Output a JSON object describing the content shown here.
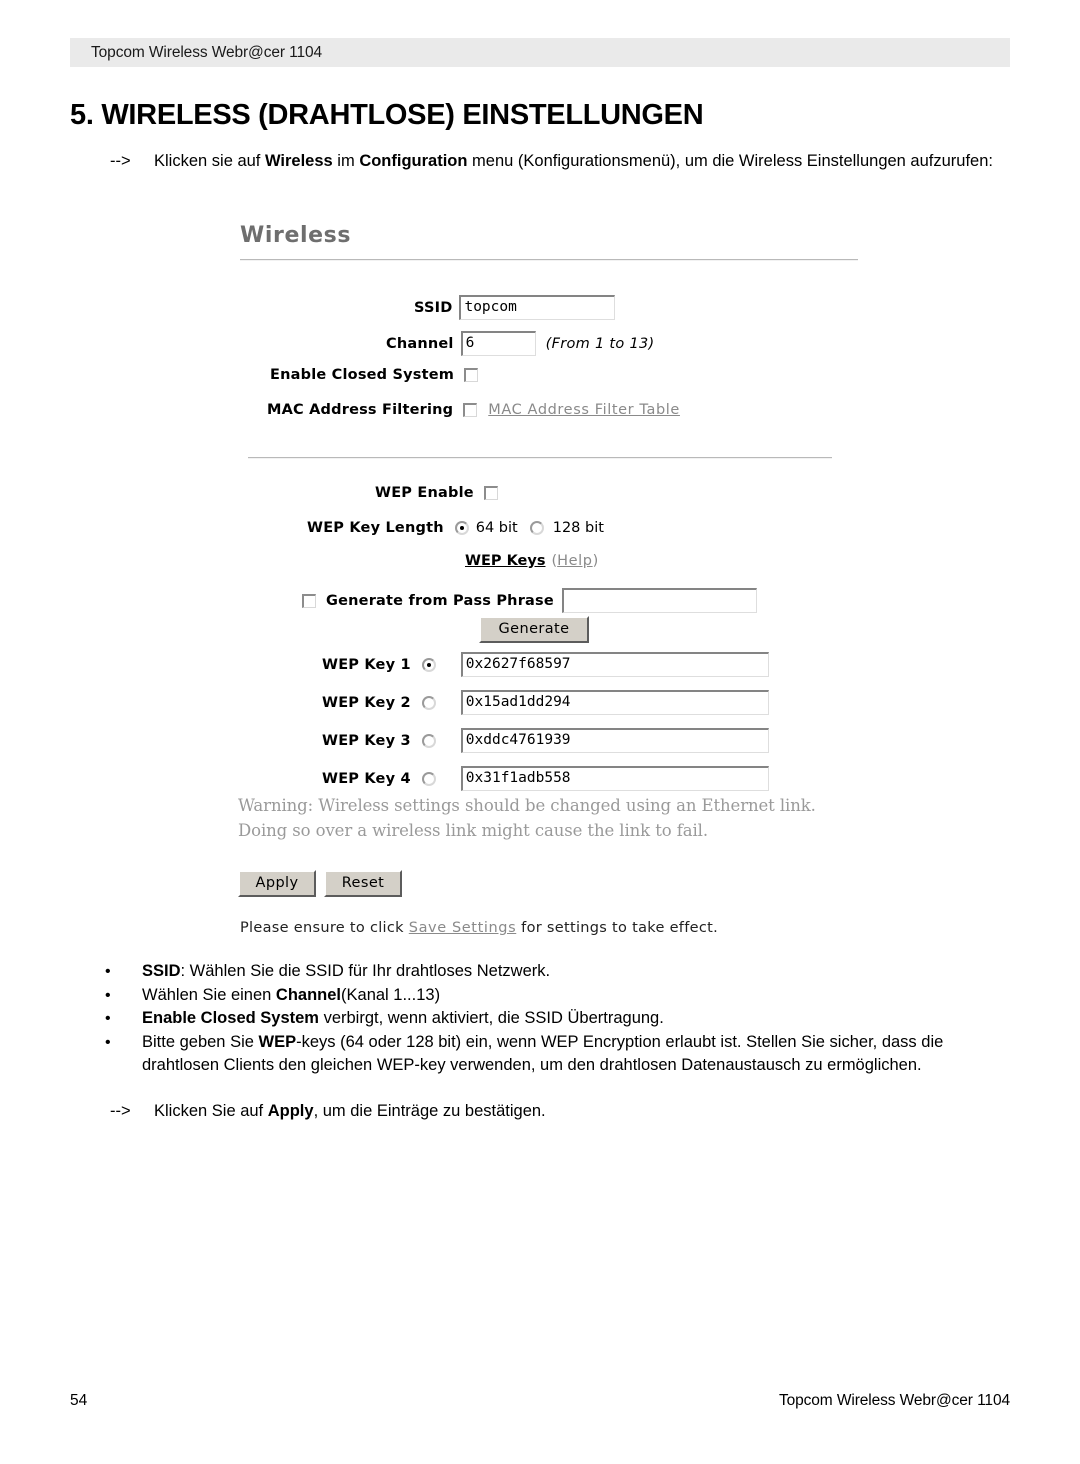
{
  "document": {
    "running_header": "Topcom Wireless Webr@cer 1104",
    "section_title": "5. WIRELESS (DRAHTLOSE) EINSTELLUNGEN",
    "intro": {
      "arrow": "-->",
      "line1_pre": "Klicken sie auf ",
      "line1_b1": "Wireless",
      "line1_mid": " im ",
      "line1_b2": "Configuration",
      "line1_post": " menu (Konfigurationsmenü), um die Wireless Einstellungen aufzurufen:"
    },
    "apply_instruction": {
      "arrow": "-->",
      "pre": "Klicken Sie auf ",
      "bold": "Apply",
      "post": ", um die Einträge zu bestätigen."
    },
    "bullets": [
      {
        "marker": "•",
        "bold_lead": "SSID",
        "text_after": ": Wählen Sie die SSID für Ihr drahtloses Netzwerk."
      },
      {
        "marker": "•",
        "text_before": "Wählen Sie einen ",
        "bold_mid": "Channel",
        "text_after": "(Kanal 1...13)"
      },
      {
        "marker": "•",
        "bold_lead": "Enable Closed System",
        "text_after": " verbirgt, wenn aktiviert, die SSID Übertragung."
      },
      {
        "marker": "•",
        "text_before": "Bitte geben Sie ",
        "bold_mid": "WEP",
        "text_after": "-keys (64 oder 128 bit) ein, wenn WEP Encryption erlaubt ist. Stellen Sie sicher, dass die drahtlosen Clients den gleichen WEP-key verwenden, um den drahtlosen Datenaustausch zu ermöglichen."
      }
    ],
    "footer": {
      "page_number": "54",
      "right_text": "Topcom Wireless Webr@cer 1104"
    }
  },
  "screenshot": {
    "panel_title": "Wireless",
    "ssid": {
      "label": "SSID",
      "value": "topcom"
    },
    "channel": {
      "label": "Channel",
      "value": "6",
      "hint": "(From 1 to 13)"
    },
    "closed_system": {
      "label": "Enable Closed System",
      "checked": false
    },
    "mac_filtering": {
      "label": "MAC Address Filtering",
      "checked": false,
      "link": "MAC Address Filter Table"
    },
    "wep_enable": {
      "label": "WEP Enable",
      "checked": false
    },
    "wep_key_length": {
      "label": "WEP Key Length",
      "option1": "64 bit",
      "option2": "128 bit",
      "selected": "64 bit"
    },
    "wep_keys_heading": {
      "title": "WEP Keys",
      "paren_open": "(",
      "help": "Help",
      "paren_close": ")"
    },
    "pass_phrase": {
      "label": "Generate from Pass Phrase",
      "checked": false,
      "value": "",
      "button": "Generate"
    },
    "wep_keys": [
      {
        "label": "WEP Key 1",
        "selected": true,
        "value": "0x2627f68597"
      },
      {
        "label": "WEP Key 2",
        "selected": false,
        "value": "0x15ad1dd294"
      },
      {
        "label": "WEP Key 3",
        "selected": false,
        "value": "0xddc4761939"
      },
      {
        "label": "WEP Key 4",
        "selected": false,
        "value": "0x31f1adb558"
      }
    ],
    "warning": {
      "line1": "Warning: Wireless settings should be changed using an Ethernet link.",
      "line2": "Doing so over a wireless link might cause the link to fail."
    },
    "buttons": {
      "apply": "Apply",
      "reset": "Reset"
    },
    "save_note": {
      "pre": "Please ensure to click ",
      "link": "Save Settings",
      "post": " for settings to take effect."
    }
  },
  "colors": {
    "header_bar": "#eaeaea",
    "panel_title": "#6e6e6e",
    "warning_text": "#9a9a9a",
    "link_gray": "#8a8a8a",
    "button_face": "#d4d0c8"
  }
}
